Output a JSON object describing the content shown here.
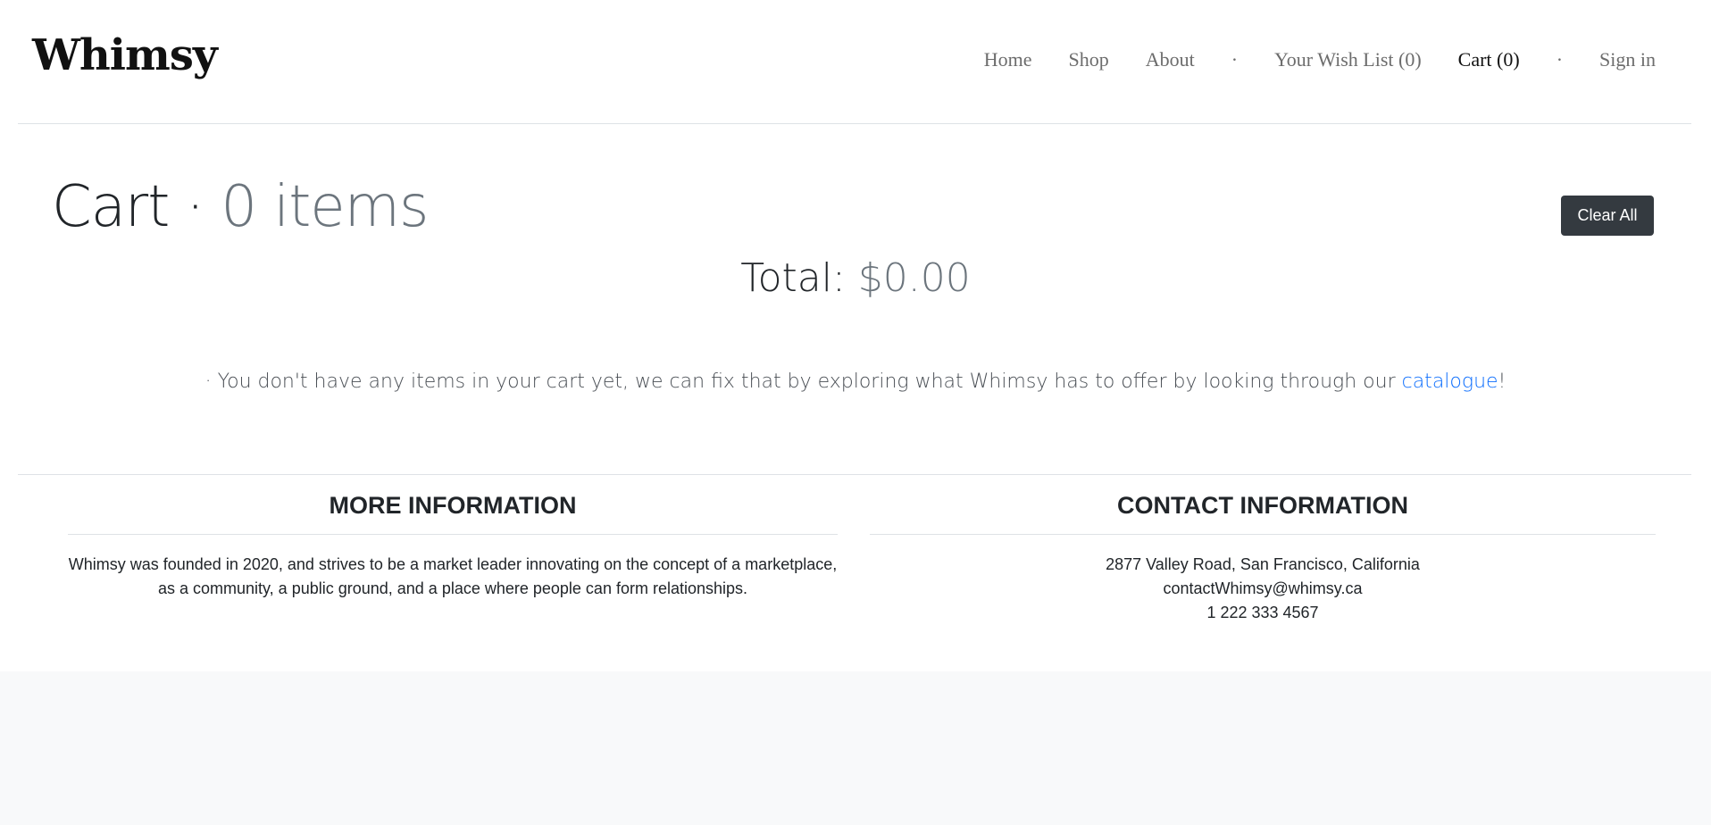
{
  "header": {
    "brand": "Whimsy",
    "nav": {
      "home": "Home",
      "shop": "Shop",
      "about": "About",
      "separator": "·",
      "wishlist": "Your Wish List (0)",
      "cart": "Cart (0)",
      "signin": "Sign in"
    }
  },
  "cart": {
    "title": "Cart",
    "title_separator": " · ",
    "item_count": "0 items",
    "clear_label": "Clear All",
    "total_label": "Total: ",
    "total_amount": "$0.00",
    "empty_prefix": "· You don't have any items in your cart yet, we can fix that by exploring what Whimsy has to offer by looking through our ",
    "empty_link": "catalogue",
    "empty_suffix": "!"
  },
  "footer": {
    "more_info": {
      "heading": "MORE INFORMATION",
      "line1": "Whimsy was founded in 2020, and strives to be a market leader innovating on the concept of a marketplace,",
      "line2": "as a community, a public ground, and a place where people can form relationships."
    },
    "contact": {
      "heading": "CONTACT INFORMATION",
      "address": "2877 Valley Road, San Francisco, California",
      "email": "contactWhimsy@whimsy.ca",
      "phone": "1 222 333 4567"
    }
  },
  "colors": {
    "primary_link": "#0d6efd",
    "dark_button": "#343a40",
    "muted": "#6c757d",
    "page_bg": "#f8f9fa"
  }
}
